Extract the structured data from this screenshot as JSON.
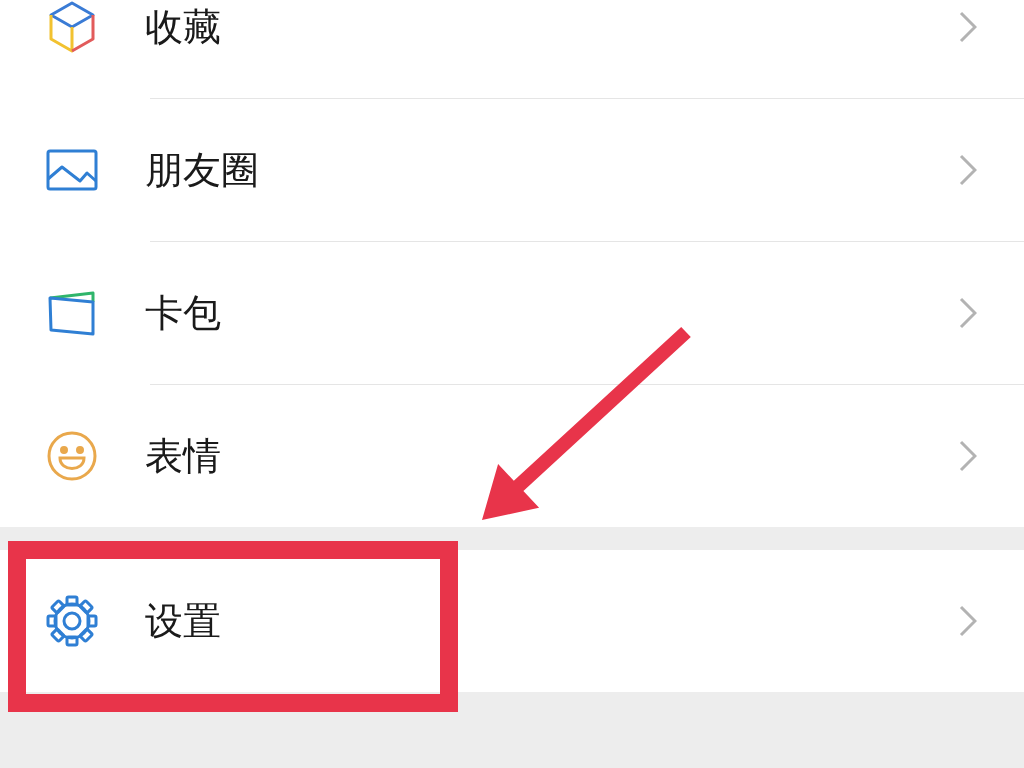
{
  "menu_groups": [
    {
      "items": [
        {
          "kind": "favorites",
          "label": "收藏"
        },
        {
          "kind": "moments",
          "label": "朋友圈"
        },
        {
          "kind": "cards",
          "label": "卡包"
        },
        {
          "kind": "stickers",
          "label": "表情"
        }
      ]
    },
    {
      "items": [
        {
          "kind": "settings",
          "label": "设置"
        }
      ]
    }
  ]
}
